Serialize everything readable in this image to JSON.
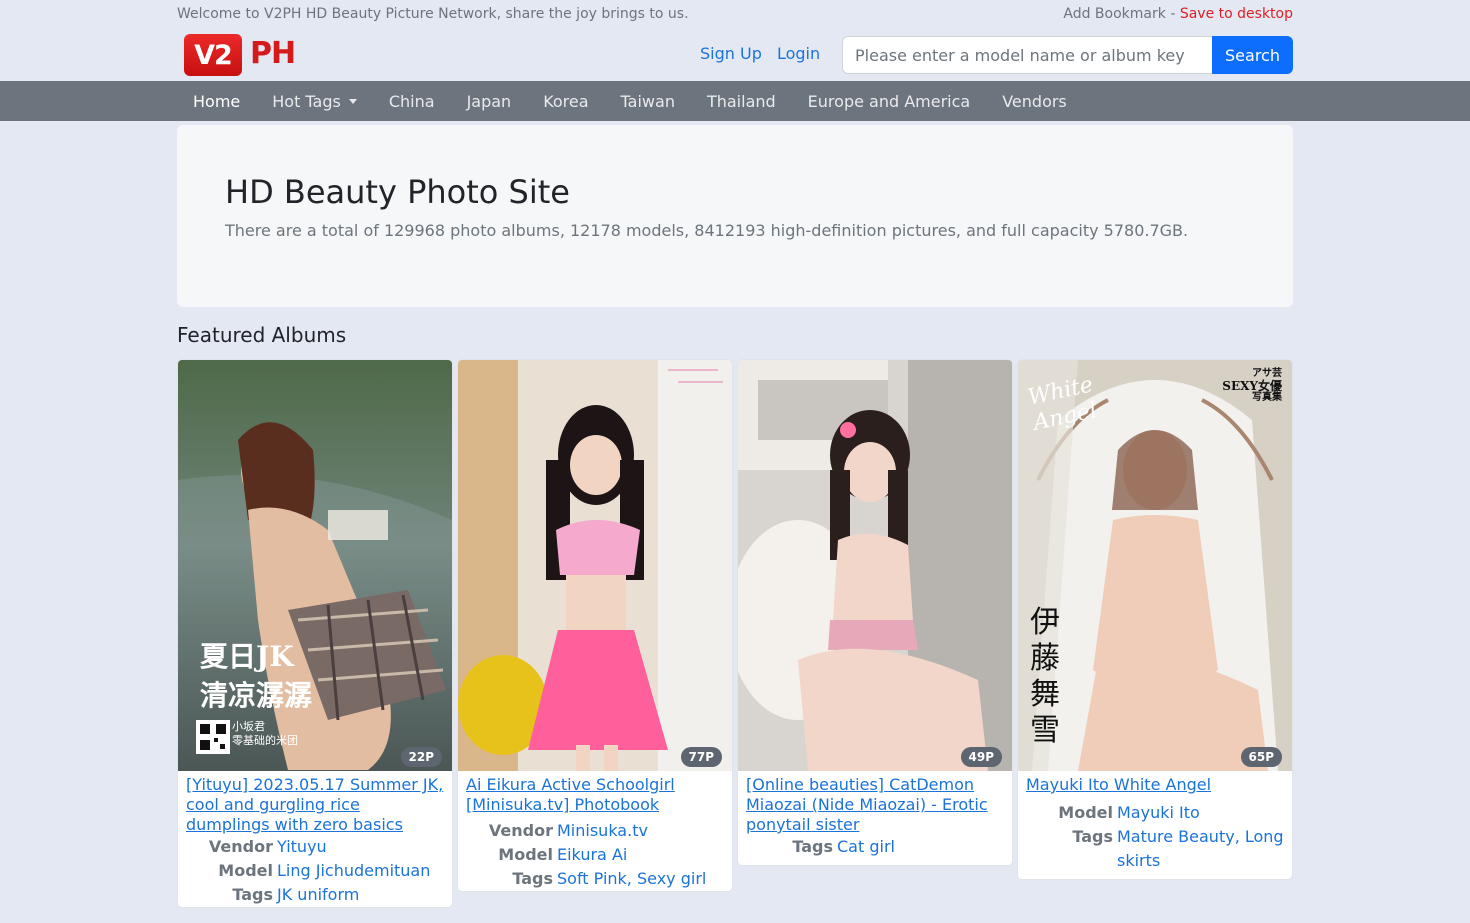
{
  "topbar": {
    "welcome": "Welcome to V2PH HD Beauty Picture Network, share the joy brings to us.",
    "add_bookmark": "Add Bookmark",
    "separator": "-",
    "save_desktop": "Save to desktop"
  },
  "logo": {
    "badge": "V2",
    "suffix": "PH"
  },
  "auth": {
    "signup": "Sign Up",
    "login": "Login"
  },
  "search": {
    "placeholder": "Please enter a model name or album key",
    "button": "Search"
  },
  "nav": {
    "items": [
      "Home",
      "Hot Tags",
      "China",
      "Japan",
      "Korea",
      "Taiwan",
      "Thailand",
      "Europe and America",
      "Vendors"
    ]
  },
  "hero": {
    "title": "HD Beauty Photo Site",
    "stats": "There are a total of 129968 photo albums, 12178 models, 8412193 high-definition pictures, and full capacity 5780.7GB."
  },
  "featured": {
    "heading": "Featured Albums",
    "labels": {
      "vendor": "Vendor",
      "model": "Model",
      "tags": "Tags"
    },
    "albums": [
      {
        "count": "22P",
        "title": "[Yituyu] 2023.05.17 Summer JK, cool and gurgling rice dumplings with zero basics",
        "vendor": "Yituyu",
        "model": "Ling Jichudemituan",
        "tags": "JK uniform",
        "cover_text_1": "夏日JK",
        "cover_text_2": "清凉潺潺",
        "cover_small_1": "小坂君",
        "cover_small_2": "零基础的米团"
      },
      {
        "count": "77P",
        "title": "Ai Eikura Active Schoolgirl [Minisuka.tv] Photobook",
        "vendor": "Minisuka.tv",
        "model": "Eikura Ai",
        "tags": "Soft Pink, Sexy girl"
      },
      {
        "count": "49P",
        "title": "[Online beauties] CatDemon Miaozai (Nide Miaozai) - Erotic ponytail sister",
        "tags": "Cat girl"
      },
      {
        "count": "65P",
        "title": "Mayuki Ito White Angel",
        "model": "Mayuki Ito",
        "tags": "Mature Beauty, Long skirts",
        "cover_script": "White Angel",
        "cover_name": "伊藤舞雪",
        "cover_brand_1": "アサ芸",
        "cover_brand_2": "SEXY女優",
        "cover_brand_3": "写真集"
      }
    ]
  },
  "colors": {
    "accent": "#0d6efd",
    "link": "#1a73d9",
    "nav_bg": "#6c757d",
    "brand_red": "#dc1f26"
  }
}
